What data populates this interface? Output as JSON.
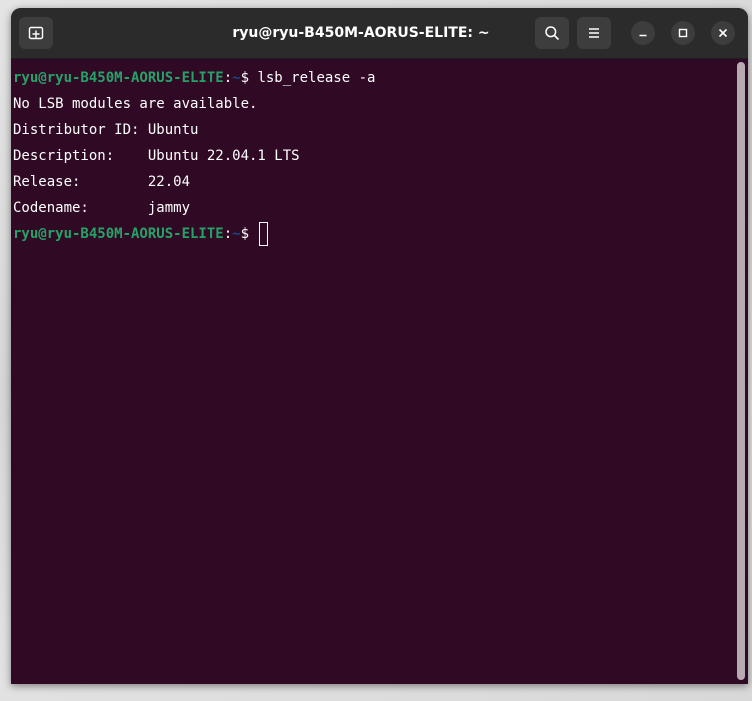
{
  "window": {
    "title": "ryu@ryu-B450M-AORUS-ELITE: ~"
  },
  "icons": {
    "new_tab": "new-tab-icon",
    "search": "search-icon",
    "menu": "hamburger-menu-icon",
    "minimize": "minimize-icon",
    "maximize": "maximize-icon",
    "close": "close-icon"
  },
  "colors": {
    "terminal_bg": "#300a24",
    "prompt_user": "#26a269",
    "prompt_path": "#12488b",
    "text": "#ffffff"
  },
  "terminal": {
    "prompt": {
      "user_host": "ryu@ryu-B450M-AORUS-ELITE",
      "colon": ":",
      "path": "~",
      "symbol": "$ "
    },
    "command": "lsb_release -a",
    "output": [
      "No LSB modules are available.",
      "Distributor ID:\tUbuntu",
      "Description:\tUbuntu 22.04.1 LTS",
      "Release:\t22.04",
      "Codename:\tjammy"
    ]
  }
}
